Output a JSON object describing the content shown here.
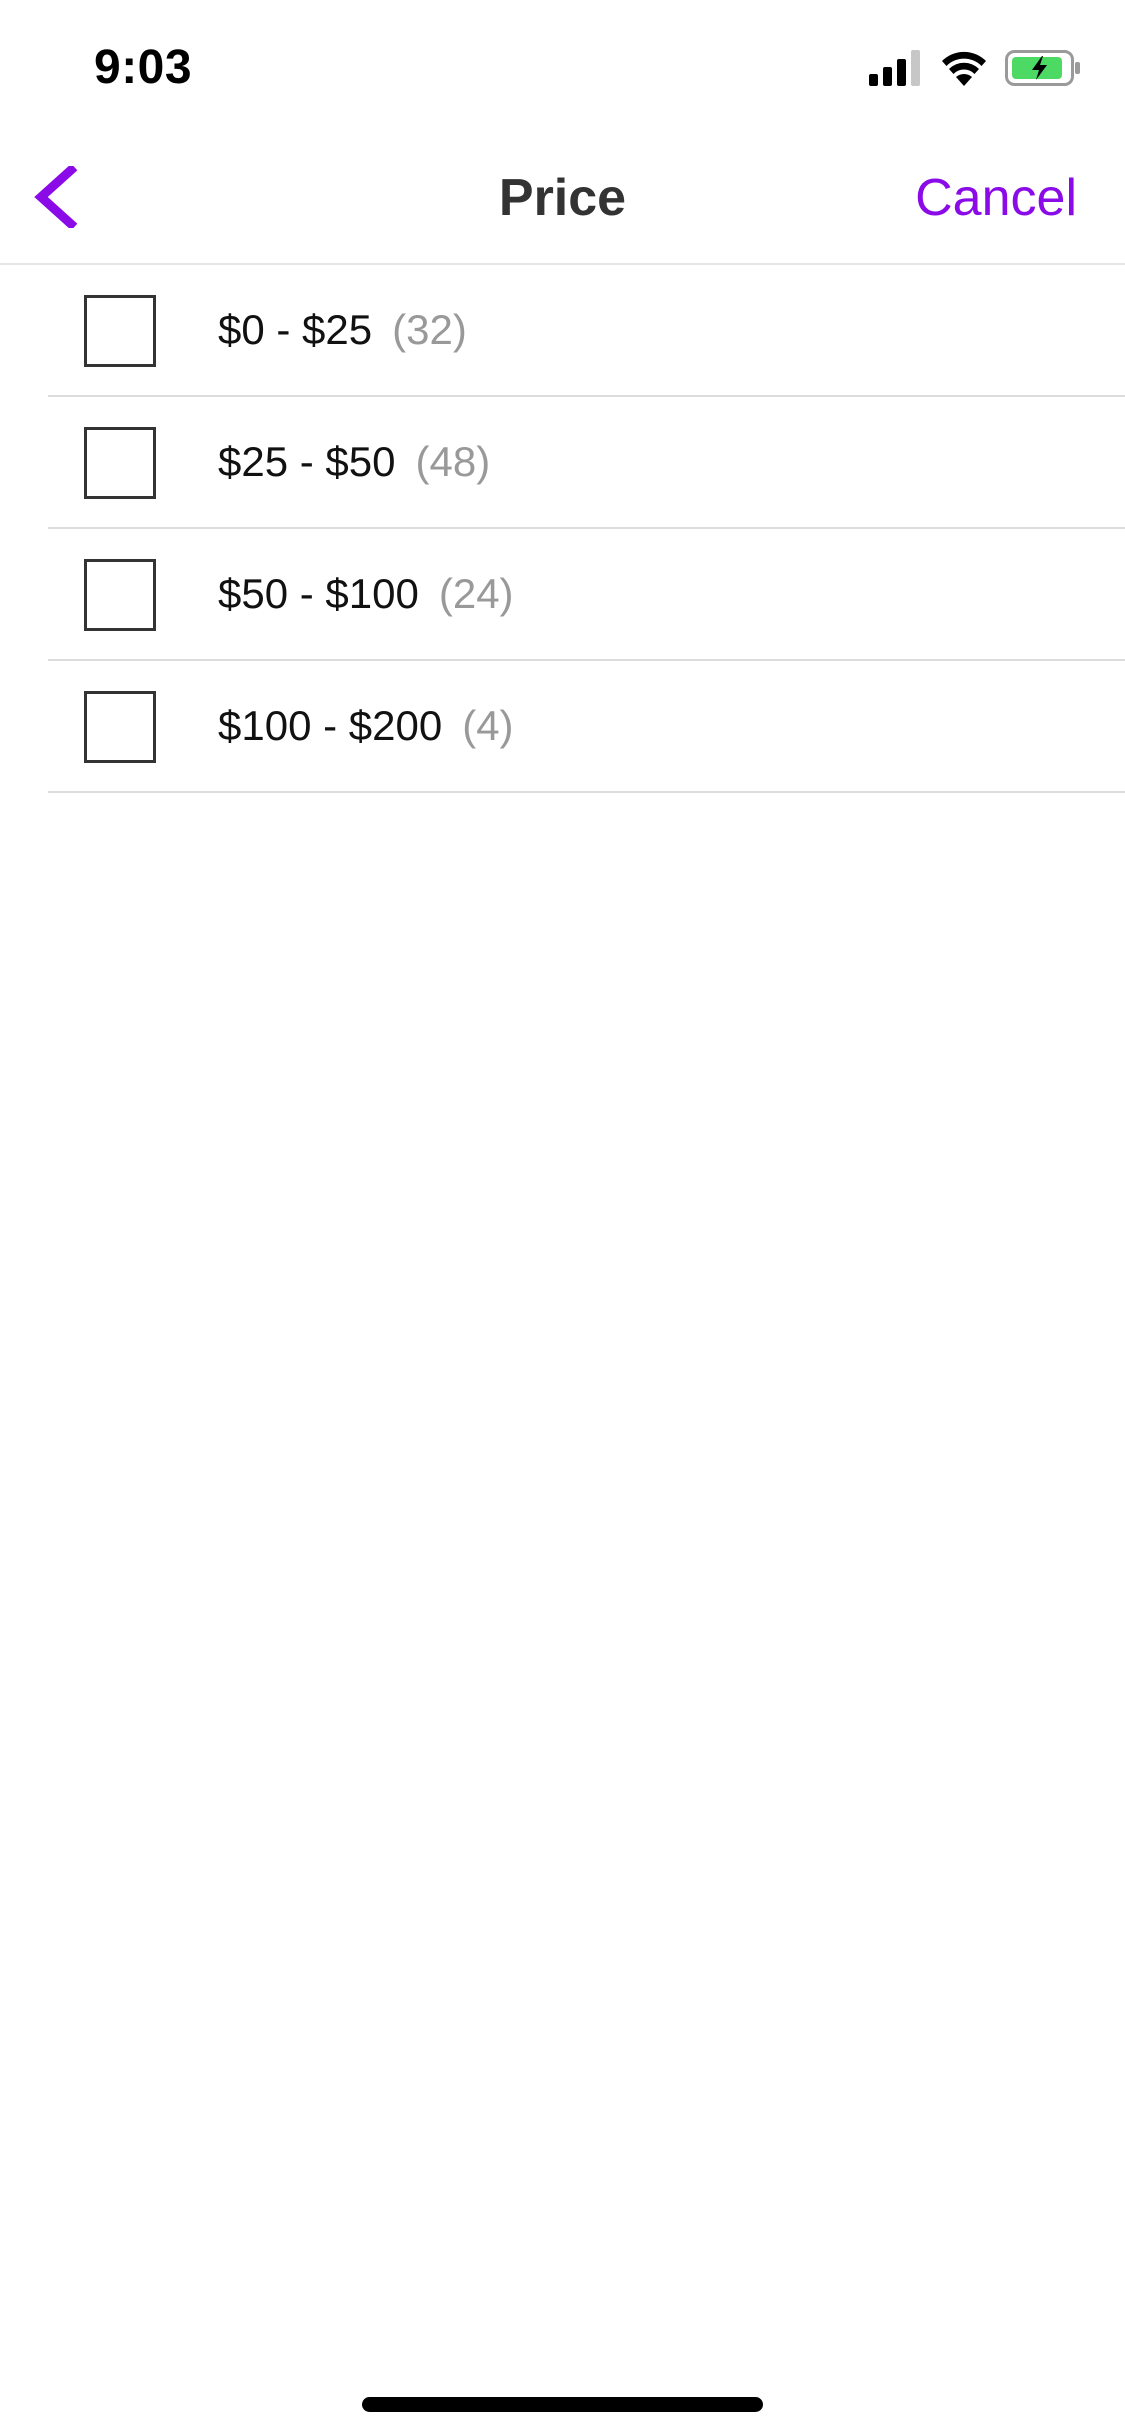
{
  "status_bar": {
    "time": "9:03",
    "icons": [
      "cellular-signal-icon",
      "wifi-icon",
      "battery-charging-icon"
    ],
    "battery_color": "#4cd964"
  },
  "nav": {
    "title": "Price",
    "back_icon": "chevron-left-icon",
    "cancel_label": "Cancel"
  },
  "theme": {
    "accent": "#8a0ae8"
  },
  "options": [
    {
      "label": "$0 - $25",
      "count": "(32)",
      "checked": false
    },
    {
      "label": "$25 - $50",
      "count": "(48)",
      "checked": false
    },
    {
      "label": "$50 - $100",
      "count": "(24)",
      "checked": false
    },
    {
      "label": "$100 - $200",
      "count": "(4)",
      "checked": false
    }
  ]
}
